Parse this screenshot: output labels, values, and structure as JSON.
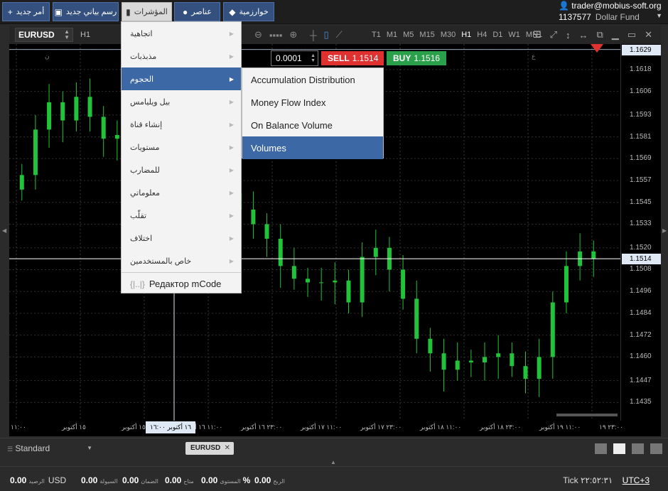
{
  "toolbar": {
    "new_order": "أمر جديد",
    "new_chart": "رسم بياني جديد",
    "indicators": "المؤشرات",
    "elements": "عناصر",
    "algorithm": "خوارزمية"
  },
  "account": {
    "email": "trader@mobius-soft.org",
    "number": "1137577",
    "fund": "Dollar Fund"
  },
  "chart_toolbar": {
    "symbol": "EURUSD",
    "timeframe": "H1",
    "timeframes": [
      "T1",
      "M1",
      "M5",
      "M15",
      "M30",
      "H1",
      "H4",
      "D1",
      "W1",
      "MN1"
    ],
    "active_timeframe": "H1"
  },
  "trade": {
    "quantity": "0.0001",
    "sell_label": "SELL",
    "sell_price": "1.1514",
    "buy_label": "BUY",
    "buy_price": "1.1516"
  },
  "menu": {
    "items": [
      "اتجاهية",
      "مذبذبات",
      "الحجوم",
      "بيل ويليامس",
      "إنشاء قناة",
      "مستويات",
      "للمضارب",
      "معلوماتي",
      "تقلّب",
      "اختلاف",
      "خاص بالمستخدمين"
    ],
    "code_editor": "Редактор mCode",
    "active_index": 2
  },
  "submenu": {
    "items": [
      "Accumulation Distribution",
      "Money Flow Index",
      "On Balance Volume",
      "Volumes"
    ],
    "active_index": 3
  },
  "chart_data": {
    "type": "candlestick",
    "symbol": "EURUSD",
    "timeframe": "H1",
    "y_ticks": [
      "1.1629",
      "1.1618",
      "1.1606",
      "1.1593",
      "1.1581",
      "1.1569",
      "1.1557",
      "1.1545",
      "1.1533",
      "1.1520",
      "1.1508",
      "1.1496",
      "1.1484",
      "1.1472",
      "1.1460",
      "1.1447",
      "1.1435"
    ],
    "ylim": [
      1.1425,
      1.1632
    ],
    "current_price": "1.1514",
    "top_price_label": "1.1629",
    "x_ticks": [
      "١١:٠٠",
      "١٥ أكتوبر",
      "٢٣:٠٠ ١٥ أكتوبر",
      "١١:٠٠ ١٦ أكتوبر",
      "٢٣:٠٠ ١٦ أكتوبر",
      "١١:٠٠ ١٧ أكتوبر",
      "٢٣:٠٠ ١٧ أكتوبر",
      "١١:٠٠ ١٨ أكتوبر",
      "٢٣:٠٠ ١٨ أكتوبر",
      "١١:٠٠ ١٩ أكتوبر",
      "٢٣:٠٠ ١٩"
    ],
    "crosshair_time": "١٦ أكتوبر ١٦:٠٠",
    "session_labels": [
      "ن",
      "ع"
    ],
    "up_color": "#22c33a",
    "down_color": "#22c33a",
    "candles_close": [
      1.156,
      1.1585,
      1.16,
      1.159,
      1.1603,
      1.1592,
      1.158,
      1.1582,
      1.1587,
      1.1583,
      1.1588,
      1.1581,
      1.1569,
      1.156,
      1.1558,
      1.155,
      1.1541,
      1.1533,
      1.1525,
      1.151,
      1.1503,
      1.1501,
      1.1501,
      1.1502,
      1.149,
      1.1515,
      1.152,
      1.1508,
      1.1492,
      1.147,
      1.1462,
      1.1453,
      1.1458,
      1.1457,
      1.146,
      1.1462,
      1.1455,
      1.1448,
      1.146,
      1.149,
      1.151,
      1.1518,
      1.1514
    ]
  },
  "layout": {
    "preset": "Standard",
    "tab": "EURUSD"
  },
  "status": {
    "balance_val": "0.00",
    "balance_label": "الرصيد",
    "currency": "USD",
    "liquidity_val": "0.00",
    "liquidity_label": "السيولة",
    "margin_val": "0.00",
    "margin_label": "الضمان",
    "available_val": "0.00",
    "available_label": "متاح",
    "level_val": "0.00",
    "level_pct": "%",
    "level_label": "المستوى",
    "profit_val": "0.00",
    "profit_label": "الربح",
    "tick_label": "Tick",
    "time": "٢٢:٥٢:٣١",
    "timezone": "UTC+3"
  }
}
